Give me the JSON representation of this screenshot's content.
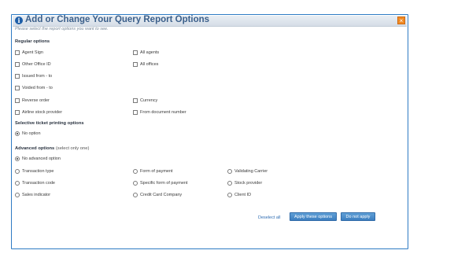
{
  "dialog": {
    "title": "Add or Change Your Query Report Options",
    "close_glyph": "×",
    "info_glyph": "i",
    "hint": "Please select the report options you want to see."
  },
  "regular": {
    "header": "Regular options",
    "items": [
      {
        "label": "Agent Sign",
        "checked": false
      },
      {
        "label": "All agents",
        "checked": false
      },
      {
        "label": "Other Office ID",
        "checked": false
      },
      {
        "label": "All offices",
        "checked": false
      },
      {
        "label": "Issued from - to",
        "checked": false
      },
      {
        "label": "Voided from - to",
        "checked": false
      },
      {
        "label": "Reverse order",
        "checked": false
      },
      {
        "label": "Currency",
        "checked": false
      },
      {
        "label": "Airline stock provider",
        "checked": false
      },
      {
        "label": "From document number",
        "checked": false
      }
    ]
  },
  "ticket": {
    "header": "Selective ticket printing options",
    "no_option": "No option"
  },
  "advanced": {
    "header": "Advanced options",
    "subheader": "(select only one)",
    "no_option": "No advanced option",
    "items": [
      {
        "label": "Transaction type"
      },
      {
        "label": "Form of payment"
      },
      {
        "label": "Validating Carrier"
      },
      {
        "label": "Transaction code"
      },
      {
        "label": "Specific form of payment"
      },
      {
        "label": "Stock provider"
      },
      {
        "label": "Sales indicator"
      },
      {
        "label": "Credit Card Company"
      },
      {
        "label": "Client ID"
      }
    ]
  },
  "footer": {
    "deselect_all": "Deselect all",
    "apply": "Apply these options",
    "do_not_apply": "Do not apply"
  }
}
